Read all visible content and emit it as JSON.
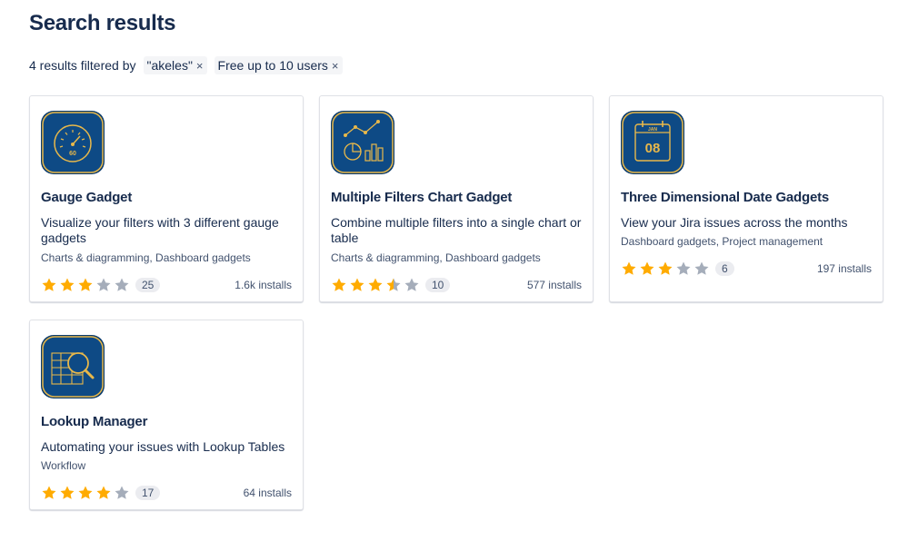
{
  "page": {
    "title": "Search results"
  },
  "filters": {
    "result_text": "4 results filtered by",
    "chips": [
      {
        "label": "\"akeles\"",
        "remove": "×"
      },
      {
        "label": "Free up to 10 users",
        "remove": "×"
      }
    ]
  },
  "apps": [
    {
      "name": "Gauge Gadget",
      "description": "Visualize your filters with 3 different gauge gadgets",
      "categories": "Charts & diagramming, Dashboard gadgets",
      "rating": 3,
      "review_count": "25",
      "installs": "1.6k installs",
      "icon": "gauge-icon",
      "icon_text": "60"
    },
    {
      "name": "Multiple Filters Chart Gadget",
      "description": "Combine multiple filters into a single chart or table",
      "categories": "Charts & diagramming, Dashboard gadgets",
      "rating": 3.5,
      "review_count": "10",
      "installs": "577 installs",
      "icon": "chart-icon"
    },
    {
      "name": "Three Dimensional Date Gadgets",
      "description": "View your Jira issues across the months",
      "categories": "Dashboard gadgets, Project management",
      "rating": 3,
      "review_count": "6",
      "installs": "197 installs",
      "icon": "calendar-icon",
      "icon_month": "JAN",
      "icon_day": "08"
    },
    {
      "name": "Lookup Manager",
      "description": "Automating your issues with Lookup Tables",
      "categories": "Workflow",
      "rating": 4,
      "review_count": "17",
      "installs": "64 installs",
      "icon": "table-search-icon"
    }
  ],
  "colors": {
    "star_filled": "#FFAB00",
    "star_empty": "#A5ADBA",
    "logo_bg": "#0B3C6E",
    "logo_line": "#E8B84A"
  }
}
